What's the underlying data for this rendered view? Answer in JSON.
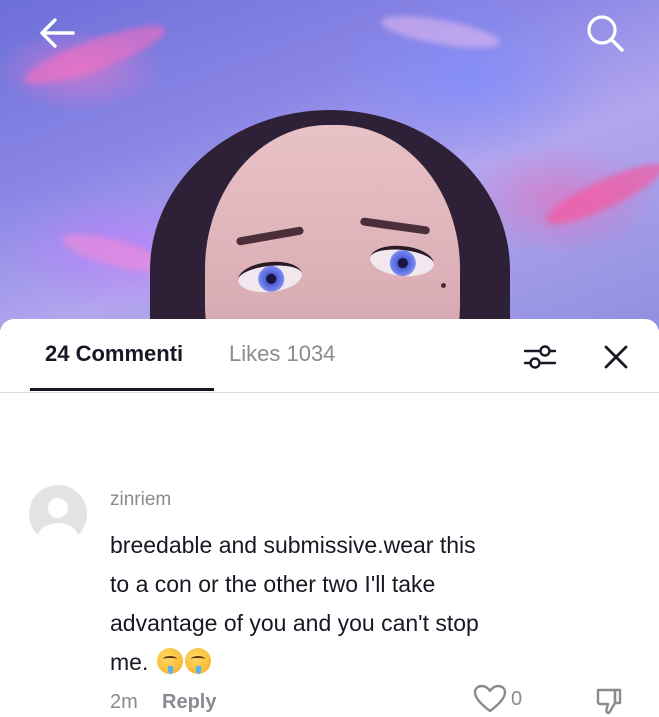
{
  "header": {
    "back_icon": "arrow-left-icon",
    "search_icon": "search-icon"
  },
  "comments_panel": {
    "tabs": [
      {
        "label": "24 Commenti",
        "active": true
      },
      {
        "label": "Likes 1034",
        "active": false
      }
    ],
    "filter_icon": "sliders-icon",
    "close_icon": "close-icon"
  },
  "comment": {
    "username": "zinriem",
    "text_lines": [
      "breedable and submissive.wear this",
      "to a con or the other two I'll take",
      "advantage of you and you can't stop",
      "me."
    ],
    "emojis": [
      "drooling-face-emoji",
      "drooling-face-emoji"
    ],
    "time": "2m",
    "reply_label": "Reply",
    "like_count": "0",
    "like_icon": "heart-outline-icon",
    "dislike_icon": "thumbs-down-icon"
  },
  "colors": {
    "primary_text": "#161823",
    "secondary_text": "#8a8b91",
    "divider": "#dcdcdc"
  }
}
